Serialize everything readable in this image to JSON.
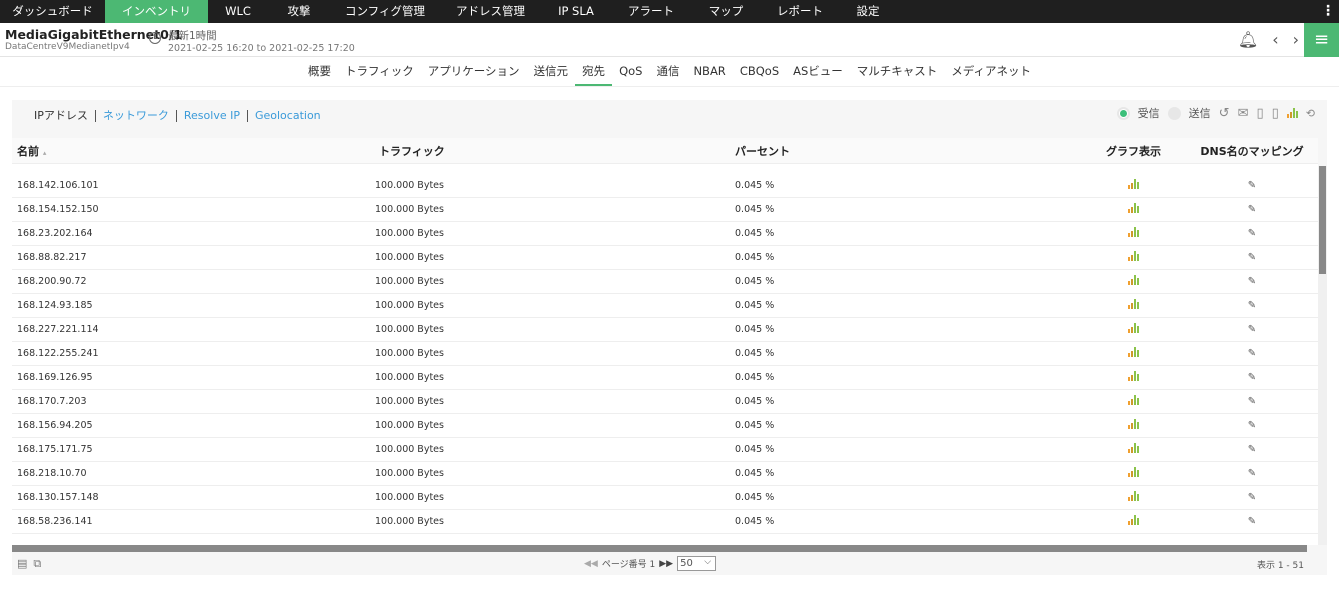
{
  "nav": {
    "items": [
      "ダッシュボード",
      "インベントリ",
      "WLC",
      "攻撃",
      "コンフィグ管理",
      "アドレス管理",
      "IP SLA",
      "アラート",
      "マップ",
      "レポート",
      "設定"
    ],
    "active": 1
  },
  "header": {
    "device": "MediaGigabitEthernet0/1",
    "device_sub": "DataCentreV9MedianetIpv4",
    "period": "最新1時間",
    "range": "2021-02-25 16:20 to 2021-02-25 17:20"
  },
  "subtabs": {
    "items": [
      "概要",
      "トラフィック",
      "アプリケーション",
      "送信元",
      "宛先",
      "QoS",
      "通信",
      "NBAR",
      "CBQoS",
      "ASビュー",
      "マルチキャスト",
      "メディアネット"
    ],
    "active": 4
  },
  "views": [
    "IPアドレス",
    "ネットワーク",
    "Resolve IP",
    "Geolocation"
  ],
  "direction": {
    "receive": "受信",
    "send": "送信",
    "selected": "受信"
  },
  "table": {
    "headers": [
      "名前",
      "トラフィック",
      "パーセント",
      "グラフ表示",
      "DNS名のマッピング"
    ],
    "rows": [
      [
        "168.142.106.101",
        "100.000 Bytes",
        "0.045 %"
      ],
      [
        "168.154.152.150",
        "100.000 Bytes",
        "0.045 %"
      ],
      [
        "168.23.202.164",
        "100.000 Bytes",
        "0.045 %"
      ],
      [
        "168.88.82.217",
        "100.000 Bytes",
        "0.045 %"
      ],
      [
        "168.200.90.72",
        "100.000 Bytes",
        "0.045 %"
      ],
      [
        "168.124.93.185",
        "100.000 Bytes",
        "0.045 %"
      ],
      [
        "168.227.221.114",
        "100.000 Bytes",
        "0.045 %"
      ],
      [
        "168.122.255.241",
        "100.000 Bytes",
        "0.045 %"
      ],
      [
        "168.169.126.95",
        "100.000 Bytes",
        "0.045 %"
      ],
      [
        "168.170.7.203",
        "100.000 Bytes",
        "0.045 %"
      ],
      [
        "168.156.94.205",
        "100.000 Bytes",
        "0.045 %"
      ],
      [
        "168.175.171.75",
        "100.000 Bytes",
        "0.045 %"
      ],
      [
        "168.218.10.70",
        "100.000 Bytes",
        "0.045 %"
      ],
      [
        "168.130.157.148",
        "100.000 Bytes",
        "0.045 %"
      ],
      [
        "168.58.236.141",
        "100.000 Bytes",
        "0.045 %"
      ]
    ]
  },
  "footer": {
    "page_label": "ページ番号 1",
    "page_size": "50",
    "count": "表示 1 - 51"
  },
  "colors": {
    "accent": "#4cb873",
    "nav_bg": "#1f1f1f",
    "link": "#3a9ad9"
  }
}
